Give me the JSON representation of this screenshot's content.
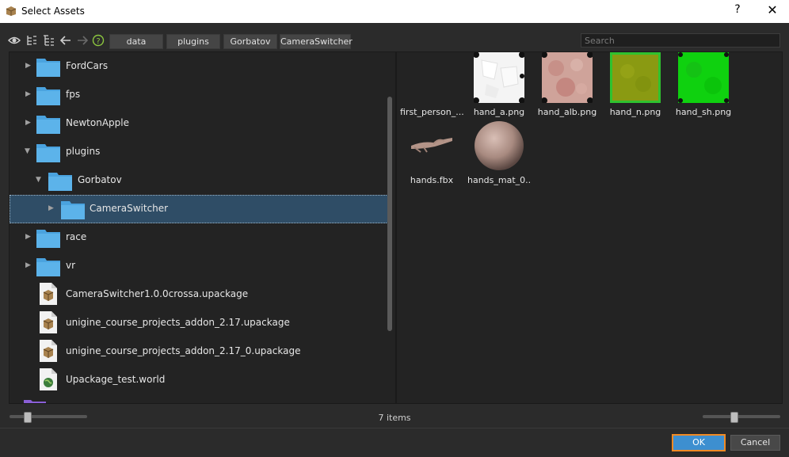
{
  "window": {
    "title": "Select Assets",
    "help_label": "?",
    "close_label": "✕"
  },
  "toolbar": {
    "icons": [
      "eye-icon",
      "tree-collapse-icon",
      "tree-expand-icon",
      "back-arrow-icon",
      "forward-arrow-icon",
      "help-circle-icon"
    ],
    "breadcrumbs": [
      "data",
      "plugins",
      "Gorbatov",
      "CameraSwitcher"
    ],
    "search_placeholder": "Search"
  },
  "tree": {
    "items": [
      {
        "label": "FordCars",
        "type": "folder",
        "expanded": false
      },
      {
        "label": "fps",
        "type": "folder",
        "expanded": false
      },
      {
        "label": "NewtonApple",
        "type": "folder",
        "expanded": false
      },
      {
        "label": "plugins",
        "type": "folder",
        "expanded": true
      },
      {
        "label": "Gorbatov",
        "type": "folder",
        "expanded": true
      },
      {
        "label": "CameraSwitcher",
        "type": "folder",
        "expanded": false,
        "selected": true
      },
      {
        "label": "race",
        "type": "folder",
        "expanded": false
      },
      {
        "label": "vr",
        "type": "folder",
        "expanded": false
      },
      {
        "label": "CameraSwitcher1.0.0crossa.upackage",
        "type": "package"
      },
      {
        "label": "unigine_course_projects_addon_2.17.upackage",
        "type": "package"
      },
      {
        "label": "unigine_course_projects_addon_2.17_0.upackage",
        "type": "package"
      },
      {
        "label": "Upackage_test.world",
        "type": "world"
      }
    ]
  },
  "assets": {
    "items": [
      {
        "label": "first_person_...",
        "kind": "node"
      },
      {
        "label": "hand_a.png",
        "kind": "texture-white"
      },
      {
        "label": "hand_alb.png",
        "kind": "texture-skin"
      },
      {
        "label": "hand_n.png",
        "kind": "texture-olive"
      },
      {
        "label": "hand_sh.png",
        "kind": "texture-green"
      },
      {
        "label": "hands.fbx",
        "kind": "mesh"
      },
      {
        "label": "hands_mat_0...",
        "kind": "material"
      }
    ]
  },
  "status": {
    "count_text": "7 items"
  },
  "sliders": {
    "left_zoom_fraction": 0.2,
    "right_zoom_fraction": 0.4
  },
  "buttons": {
    "ok_label": "OK",
    "cancel_label": "Cancel"
  },
  "colors": {
    "selection": "#2f4d66",
    "accent": "#3d8fd0",
    "focus_border": "#f08a24",
    "folder": "#4aa3df"
  }
}
